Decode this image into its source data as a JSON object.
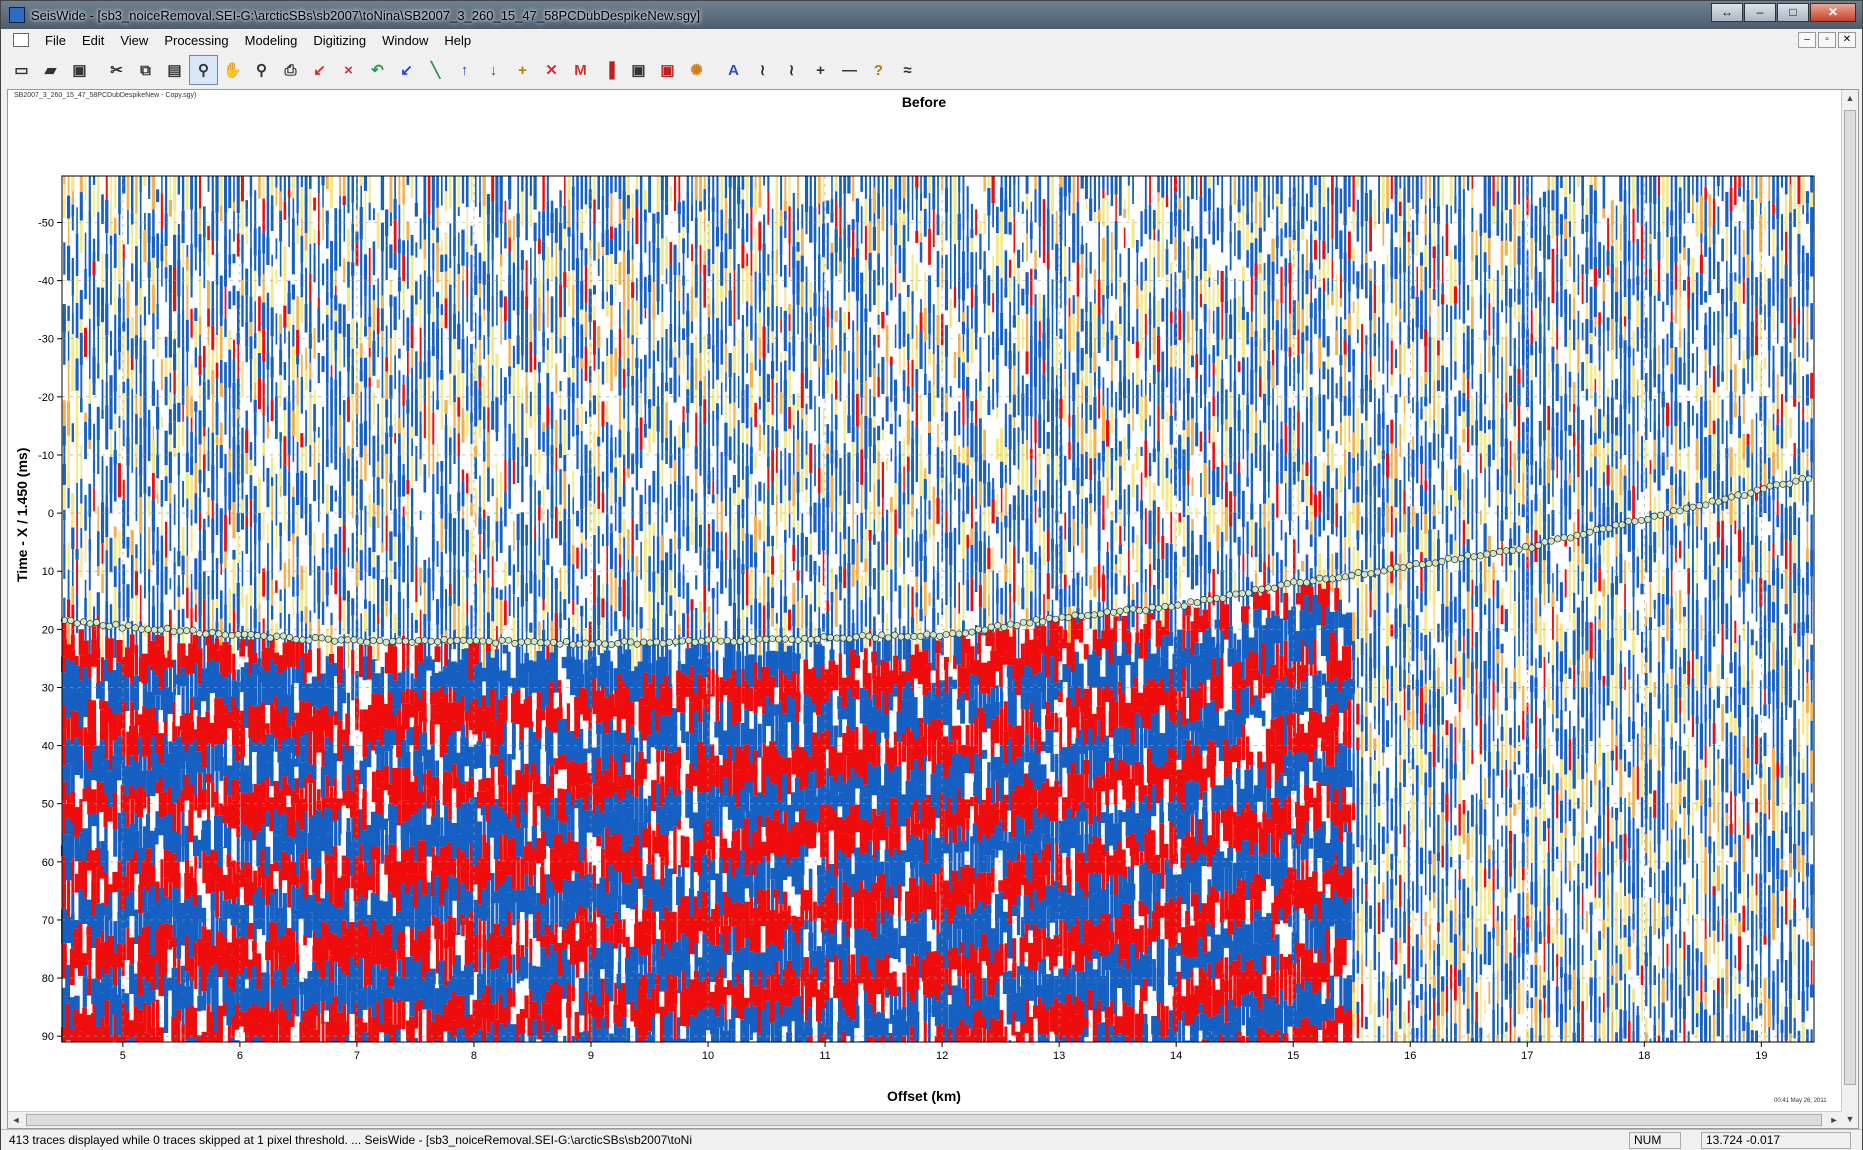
{
  "window": {
    "title": "SeisWide - [sb3_noiceRemoval.SEI-G:\\arcticSBs\\sb2007\\toNina\\SB2007_3_260_15_47_58PCDubDespikeNew.sgy]",
    "controls": [
      "↔",
      "–",
      "□",
      "✕"
    ]
  },
  "menu": [
    "File",
    "Edit",
    "View",
    "Processing",
    "Modeling",
    "Digitizing",
    "Window",
    "Help"
  ],
  "mdi_controls": [
    "–",
    "▫",
    "✕"
  ],
  "toolbar": {
    "buttons": [
      {
        "icon": "new-document-icon",
        "glyph": "▭"
      },
      {
        "icon": "open-folder-icon",
        "glyph": "▰"
      },
      {
        "icon": "save-icon",
        "glyph": "▣"
      },
      {
        "sep": true
      },
      {
        "icon": "cut-icon",
        "glyph": "✂"
      },
      {
        "icon": "copy-icon",
        "glyph": "⧉"
      },
      {
        "icon": "paste-icon",
        "glyph": "▤"
      },
      {
        "icon": "zoom-icon",
        "glyph": "⚲",
        "active": true
      },
      {
        "icon": "pan-hand-icon",
        "glyph": "✋"
      },
      {
        "icon": "zoom-out-icon",
        "glyph": "⚲"
      },
      {
        "icon": "print-icon",
        "glyph": "⎙"
      },
      {
        "icon": "pick-icon",
        "glyph": "↙",
        "color": "#d03030"
      },
      {
        "icon": "delete-pick-icon",
        "glyph": "×",
        "color": "#d03030"
      },
      {
        "icon": "undo-icon",
        "glyph": "↶",
        "color": "#2a9a4a"
      },
      {
        "icon": "pick-blue-icon",
        "glyph": "↙",
        "color": "#2a4ad0"
      },
      {
        "icon": "line-green-icon",
        "glyph": "╲",
        "color": "#2a9a4a"
      },
      {
        "icon": "arrow-up-icon",
        "glyph": "↑",
        "color": "#2050c0"
      },
      {
        "icon": "arrow-down-icon",
        "glyph": "↓",
        "color": "#2050c0"
      },
      {
        "icon": "add-point-icon",
        "glyph": "+",
        "color": "#b08000"
      },
      {
        "icon": "remove-point-icon",
        "glyph": "✕",
        "color": "#d03030"
      },
      {
        "icon": "mark-icon",
        "glyph": "M",
        "color": "#d03030"
      },
      {
        "icon": "color-map-icon",
        "glyph": "▐",
        "color": "#c02020"
      },
      {
        "icon": "save-picks-icon",
        "glyph": "▣"
      },
      {
        "icon": "save-picks-red-icon",
        "glyph": "▣",
        "color": "#c02020"
      },
      {
        "icon": "spectrum-icon",
        "glyph": "✺",
        "color": "#d08020"
      },
      {
        "sep": true
      },
      {
        "icon": "amplitude-icon",
        "glyph": "A",
        "color": "#3050c0"
      },
      {
        "icon": "wiggle-icon",
        "glyph": "≀"
      },
      {
        "icon": "wiggle-fill-icon",
        "glyph": "≀"
      },
      {
        "icon": "crosshair-icon",
        "glyph": "+"
      },
      {
        "icon": "hline-icon",
        "glyph": "—"
      },
      {
        "icon": "help-icon",
        "glyph": "?",
        "color": "#b08000"
      },
      {
        "icon": "seismic-icon",
        "glyph": "≈"
      }
    ]
  },
  "document": {
    "file_label": "SB2007_3_260_15_47_58PCDubDespikeNew - Copy.sgy)",
    "plot_title": "Before",
    "timestamp": "00:41 May 26, 2011"
  },
  "chart_data": {
    "type": "seismic-section",
    "title": "Before",
    "xlabel": "Offset (km)",
    "ylabel": "Time - X / 1.450 (ms)",
    "xlim": [
      4.48,
      19.45
    ],
    "ylim": [
      -58,
      91
    ],
    "y_inverted": true,
    "xticks": [
      5,
      6,
      7,
      8,
      9,
      10,
      11,
      12,
      13,
      14,
      15,
      16,
      17,
      18,
      19
    ],
    "yticks": [
      -50,
      -40,
      -30,
      -20,
      -10,
      0,
      10,
      20,
      30,
      40,
      50,
      60,
      70,
      80,
      90
    ],
    "grid": true,
    "first_break_picks": {
      "x": [
        4.5,
        5.0,
        6.0,
        7.0,
        8.0,
        9.0,
        10.0,
        11.0,
        12.0,
        13.0,
        14.0,
        15.0,
        15.4,
        16.0,
        17.0,
        18.0,
        19.0,
        19.4
      ],
      "y": [
        18.5,
        19.5,
        21,
        22,
        22,
        22.5,
        22,
        21.5,
        21,
        18,
        16,
        12,
        11,
        9,
        6,
        1,
        -4,
        -6
      ]
    },
    "colors": {
      "positive": "#ef0c0c",
      "negative": "#1560c2",
      "weak_positive": "#f4e98a",
      "weak_positive_2": "#f3b150",
      "picks": "#cfe8c8"
    },
    "trace_count_displayed": 413
  },
  "status": {
    "message": "413 traces displayed while 0 traces skipped at 1 pixel threshold. ... SeisWide - [sb3_noiceRemoval.SEI-G:\\arcticSBs\\sb2007\\toNi",
    "num": "NUM",
    "coords": "13.724   -0.017"
  },
  "scroll": {
    "up": "▲",
    "down": "▼",
    "left": "◄",
    "right": "►"
  }
}
